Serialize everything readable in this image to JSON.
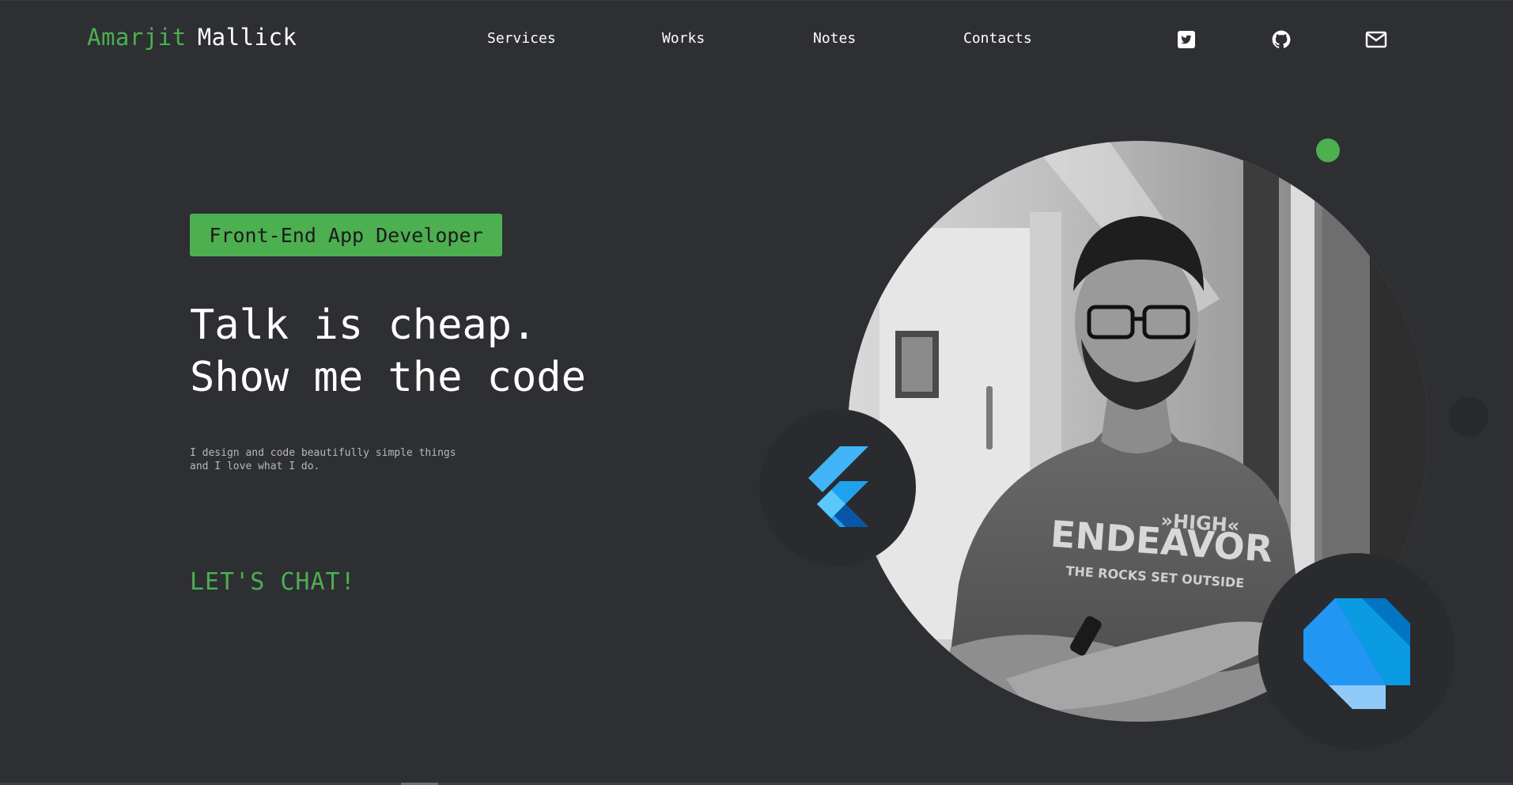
{
  "header": {
    "brand_first": "Amarjit",
    "brand_last": "Mallick",
    "nav": [
      "Services",
      "Works",
      "Notes",
      "Contacts"
    ],
    "social_icons": [
      "twitter-icon",
      "github-icon",
      "mail-icon"
    ]
  },
  "hero": {
    "tag": "Front-End App Developer",
    "headline_line1": "Talk is cheap.",
    "headline_line2": "Show me the code",
    "desc_line1": "I design and code beautifully simple things",
    "desc_line2": "and I love what I do.",
    "cta": "LET'S CHAT!",
    "tech_badges": [
      "flutter-logo",
      "dart-logo"
    ]
  },
  "colors": {
    "background": "#2e2f33",
    "accent": "#4caf50",
    "badge_bg": "#2a2b2f",
    "text": "#ffffff",
    "muted_text": "#b7b8bc"
  }
}
